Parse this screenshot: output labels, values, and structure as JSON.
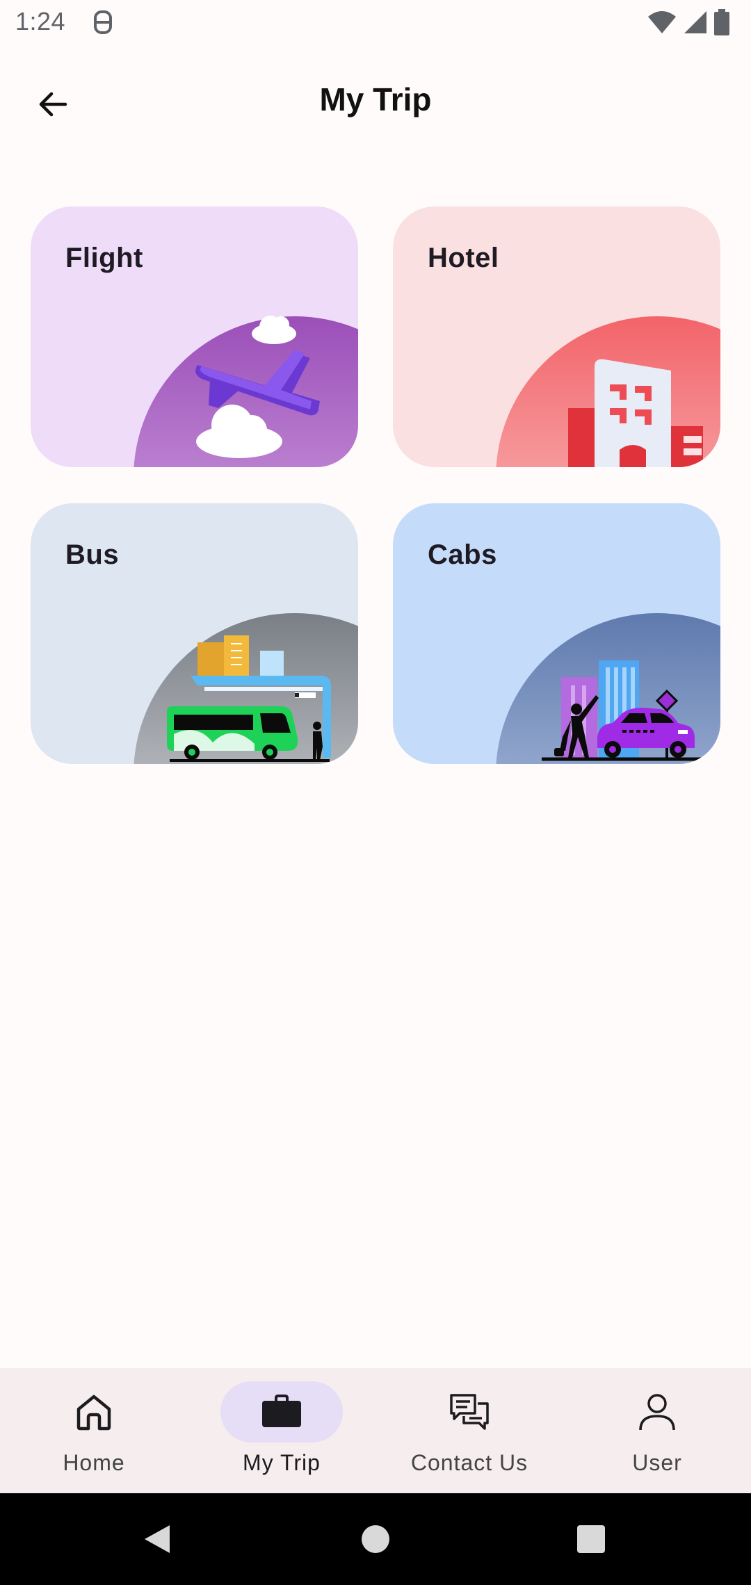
{
  "status_bar": {
    "time": "1:24"
  },
  "header": {
    "title": "My Trip"
  },
  "cards": [
    {
      "label": "Flight",
      "bg": "#EFDCF9"
    },
    {
      "label": "Hotel",
      "bg": "#FBE0E1"
    },
    {
      "label": "Bus",
      "bg": "#DDE6F1"
    },
    {
      "label": "Cabs",
      "bg": "#C4DCFA"
    }
  ],
  "bottom_nav": {
    "items": [
      {
        "label": "Home",
        "icon": "home-icon"
      },
      {
        "label": "My Trip",
        "icon": "briefcase-icon",
        "active": true
      },
      {
        "label": "Contact Us",
        "icon": "chat-icon"
      },
      {
        "label": "User",
        "icon": "person-icon"
      }
    ]
  },
  "colors": {
    "accent_pill": "#E6DDF6",
    "nav_bg": "#F6EEEE",
    "page_bg": "#FFFBFB"
  }
}
